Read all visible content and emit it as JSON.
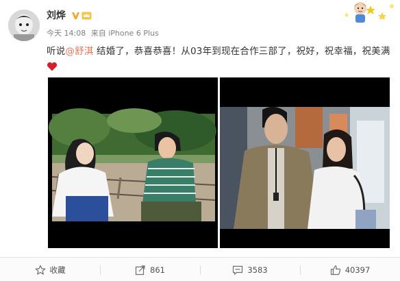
{
  "post": {
    "author": "刘烨",
    "time": "今天 14:08",
    "source": "来自 iPhone 6 Plus",
    "content": {
      "before": "听说",
      "mention": "@舒淇",
      "after": " 结婚了，恭喜恭喜！从03年到现在合作三部了，祝好，祝幸福，祝美满"
    },
    "verified_color": "#f5a623",
    "mention_color": "#eb7350"
  },
  "actions": {
    "favorite": {
      "label": "收藏",
      "icon": "star-icon"
    },
    "share": {
      "count": "861",
      "icon": "share-icon"
    },
    "comment": {
      "count": "3583",
      "icon": "comment-icon"
    },
    "like": {
      "count": "40397",
      "icon": "thumbs-up-icon"
    }
  }
}
